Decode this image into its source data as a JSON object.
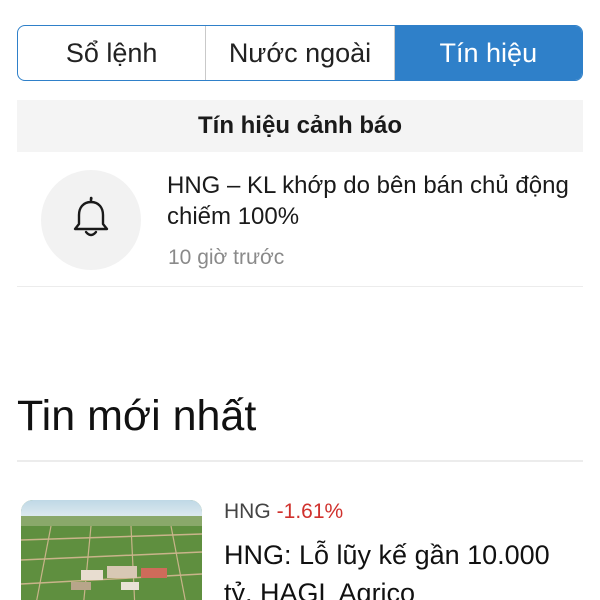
{
  "tabs": [
    {
      "label": "Sổ lệnh",
      "active": false
    },
    {
      "label": "Nước ngoài",
      "active": false
    },
    {
      "label": "Tín hiệu",
      "active": true
    }
  ],
  "signals": {
    "header": "Tín hiệu cảnh báo",
    "items": [
      {
        "icon": "bell-icon",
        "text": "HNG – KL khớp do bên bán chủ động chiếm 100%",
        "time": "10 giờ trước"
      }
    ]
  },
  "news": {
    "title": "Tin mới nhất",
    "items": [
      {
        "ticker": "HNG",
        "change": "-1.61%",
        "headline": "HNG: Lỗ lũy kế gần 10.000 tỷ, HAGL Agrico"
      }
    ]
  },
  "colors": {
    "accent": "#2f80c9",
    "negative": "#d0312d"
  }
}
